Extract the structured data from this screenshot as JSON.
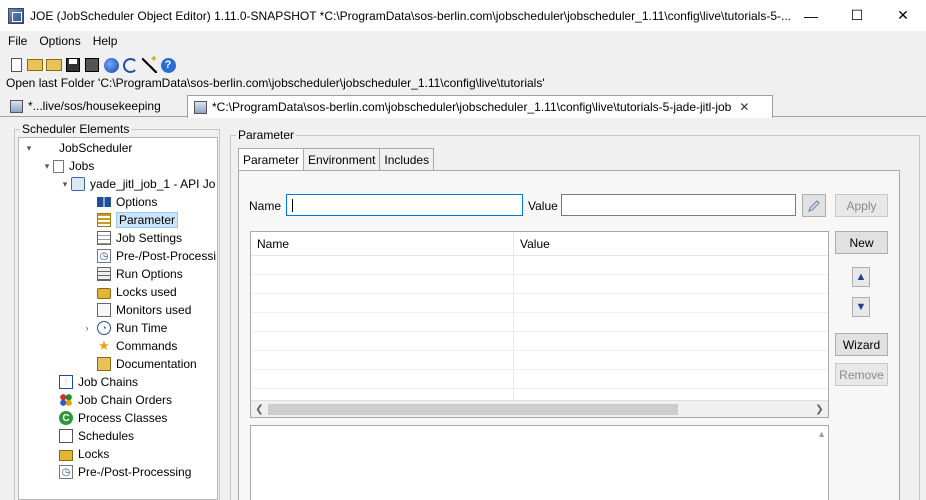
{
  "window": {
    "title": "JOE (JobScheduler Object Editor) 1.11.0-SNAPSHOT *C:\\ProgramData\\sos-berlin.com\\jobscheduler\\jobscheduler_1.11\\config\\live\\tutorials-5-...",
    "minimize": "—",
    "maximize": "☐",
    "close": "✕"
  },
  "menu": [
    "File",
    "Options",
    "Help"
  ],
  "toolbar": {
    "icons": [
      "new-icon",
      "open-icon",
      "open-folder-icon",
      "save-icon",
      "save-as-icon",
      "globe-icon",
      "undo-icon",
      "wizard-icon",
      "help-icon"
    ],
    "help_glyph": "?"
  },
  "last_folder": "Open last Folder 'C:\\ProgramData\\sos-berlin.com\\jobscheduler\\jobscheduler_1.11\\config\\live\\tutorials'",
  "editor_tabs": [
    {
      "label": "*...live/sos/housekeeping",
      "active": false
    },
    {
      "label": "*C:\\ProgramData\\sos-berlin.com\\jobscheduler\\jobscheduler_1.11\\config\\live\\tutorials-5-jade-jitl-job",
      "active": true,
      "close": "✕"
    }
  ],
  "left_panel": {
    "title": "Scheduler Elements",
    "tree": {
      "root": "JobScheduler",
      "jobs": "Jobs",
      "job": "yade_jitl_job_1 - API Jo",
      "job_children": [
        "Options",
        "Parameter",
        "Job Settings",
        "Pre-/Post-Processi",
        "Run Options",
        "Locks used",
        "Monitors used",
        "Run Time",
        "Commands",
        "Documentation"
      ],
      "root_children": [
        "Job Chains",
        "Job Chain Orders",
        "Process Classes",
        "Schedules",
        "Locks",
        "Pre-/Post-Processing"
      ]
    }
  },
  "right_panel": {
    "title": "Parameter",
    "tabs": [
      "Parameter",
      "Environment",
      "Includes"
    ],
    "name_label": "Name",
    "name_value": "",
    "value_label": "Value",
    "value_value": "",
    "apply": "Apply",
    "new": "New",
    "up": "▲",
    "down": "▼",
    "wizard": "Wizard",
    "remove": "Remove",
    "table": {
      "columns": [
        "Name",
        "Value"
      ],
      "rows": []
    }
  }
}
